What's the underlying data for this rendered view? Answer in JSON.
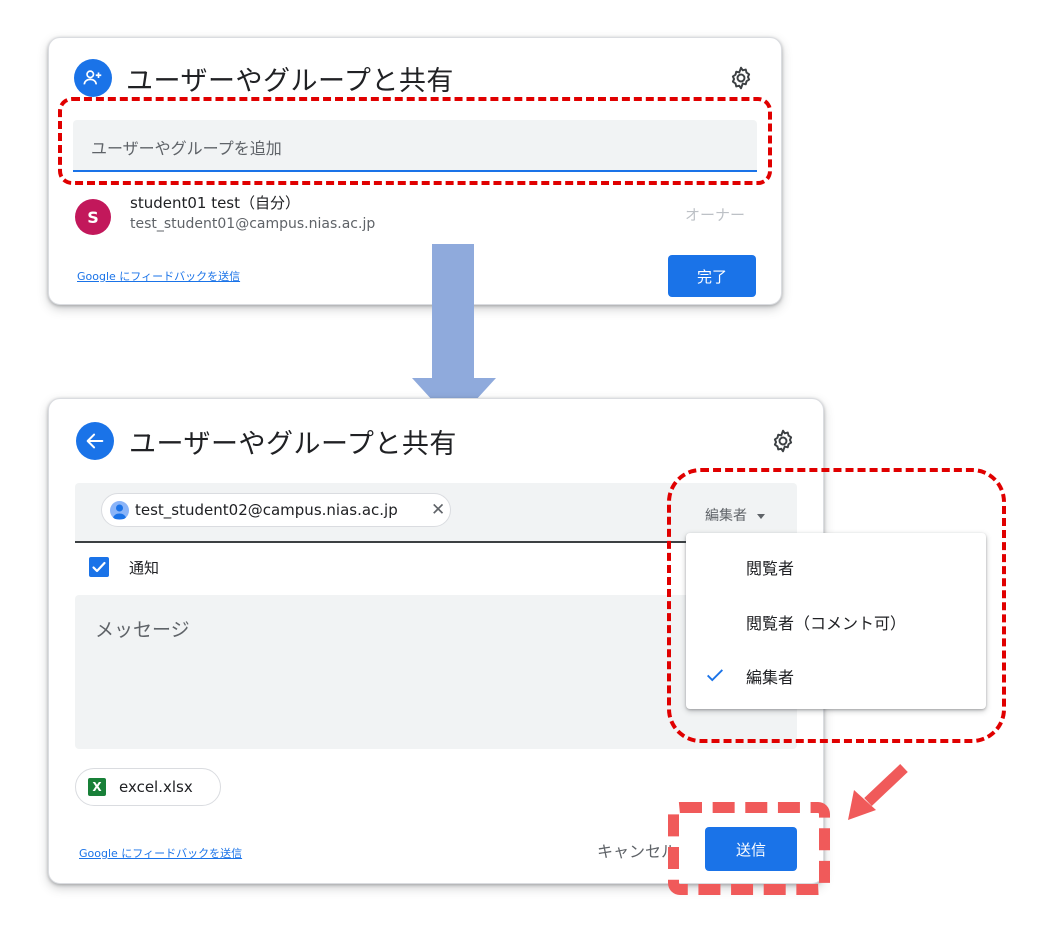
{
  "dialog1": {
    "title": "ユーザーやグループと共有",
    "add_placeholder": "ユーザーやグループを追加",
    "user": {
      "avatar_letter": "S",
      "name": "student01 test（自分）",
      "email": "test_student01@campus.nias.ac.jp",
      "role": "オーナー"
    },
    "feedback_link": "Google にフィードバックを送信",
    "done_button": "完了"
  },
  "dialog2": {
    "title": "ユーザーやグループと共有",
    "recipient_chip": "test_student02@campus.nias.ac.jp",
    "chip_remove": "✕",
    "role_selected": "編集者",
    "notify_label": "通知",
    "notify_checked": true,
    "message_placeholder": "メッセージ",
    "file_icon_letter": "X",
    "file_name": "excel.xlsx",
    "feedback_link": "Google にフィードバックを送信",
    "cancel_button": "キャンセル",
    "send_button": "送信"
  },
  "role_menu": {
    "options": [
      "閲覧者",
      "閲覧者（コメント可）",
      "編集者"
    ],
    "selected_index": 2
  },
  "icons": {
    "dialog1_header": "person-add-icon",
    "dialog2_header": "back-arrow-icon",
    "settings": "gear-icon",
    "selected": "check-icon"
  },
  "colors": {
    "accent": "#1a73e8",
    "avatar": "#c2185b",
    "file_icon": "#188038",
    "flow_arrow": "#8faadc",
    "annotation_red": "#e00000",
    "annotation_coral": "#f05a5a"
  }
}
